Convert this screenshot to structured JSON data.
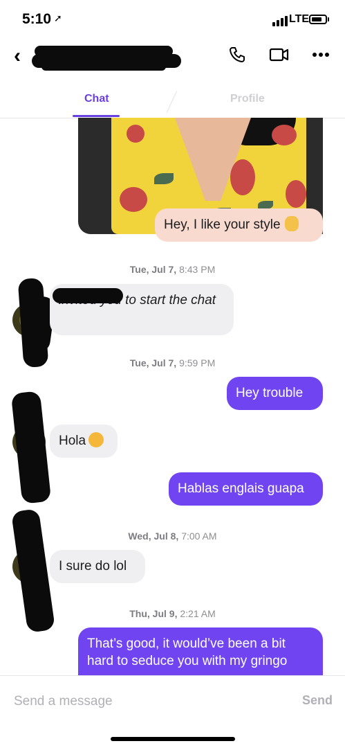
{
  "status_bar": {
    "time": "5:10",
    "network": "LTE"
  },
  "header": {
    "back_icon": "chevron-left-icon",
    "contact_name_redacted": true,
    "icons": [
      "phone-icon",
      "video-camera-icon",
      "more-icon"
    ]
  },
  "tabs": [
    {
      "label": "Chat",
      "active": true
    },
    {
      "label": "Profile",
      "active": false
    }
  ],
  "messages": [
    {
      "type": "photo",
      "direction": "out"
    },
    {
      "type": "text",
      "direction": "out",
      "style": "peach",
      "text": "Hey, I like your style",
      "emoji": "ok-hand-emoji"
    },
    {
      "type": "timestamp",
      "day": "Tue, Jul 7,",
      "time": "8:43 PM"
    },
    {
      "type": "text",
      "direction": "in",
      "style": "italic",
      "text": "invited you to start the chat"
    },
    {
      "type": "timestamp",
      "day": "Tue, Jul 7,",
      "time": "9:59 PM"
    },
    {
      "type": "text",
      "direction": "out",
      "text": "Hey trouble"
    },
    {
      "type": "text",
      "direction": "in",
      "text": "Hola",
      "emoji": "hugging-face-emoji"
    },
    {
      "type": "text",
      "direction": "out",
      "text": "Hablas englais guapa"
    },
    {
      "type": "timestamp",
      "day": "Wed, Jul 8,",
      "time": "7:00 AM"
    },
    {
      "type": "text",
      "direction": "in",
      "text": "I sure do lol"
    },
    {
      "type": "timestamp",
      "day": "Thu, Jul 9,",
      "time": "2:21 AM"
    },
    {
      "type": "text",
      "direction": "out",
      "text": "That’s good, it would’ve been a bit hard to seduce you with my gringo"
    }
  ],
  "composer": {
    "placeholder": "Send a message",
    "send_label": "Send"
  },
  "colors": {
    "accent": "#6a3fe0",
    "outgoing_bubble": "#7044f0",
    "incoming_bubble": "#efeff2",
    "peach_bubble": "#f8dace"
  }
}
